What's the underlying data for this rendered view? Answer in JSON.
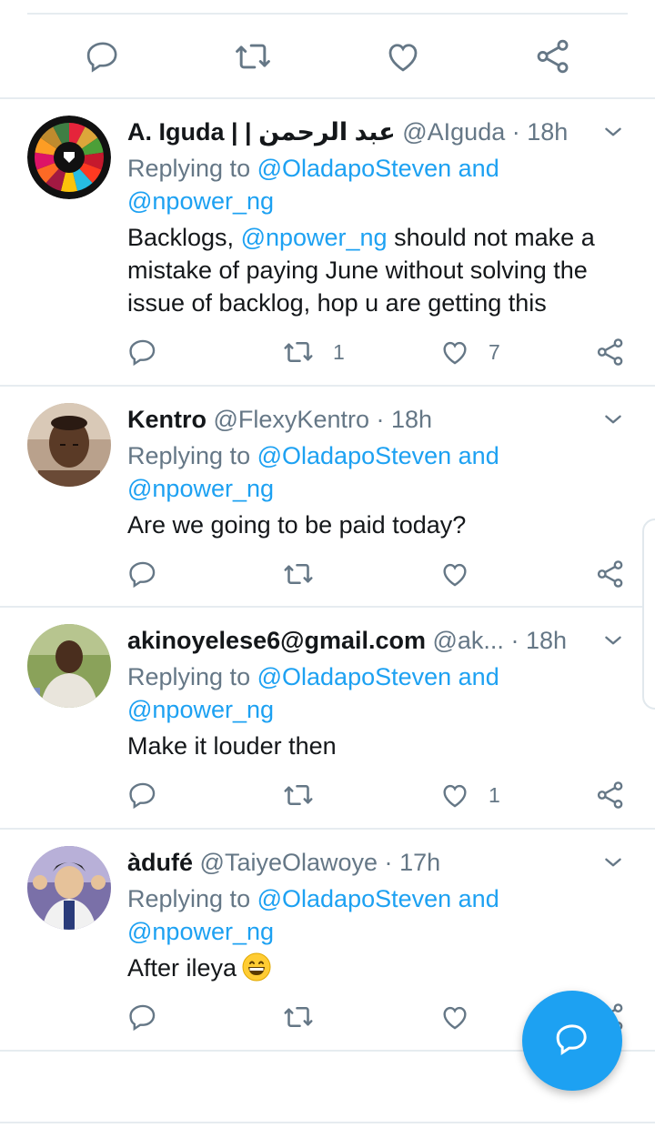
{
  "top_actions": [
    "reply-icon",
    "retweet-icon",
    "like-icon",
    "share-icon"
  ],
  "tweets": [
    {
      "name": "A. Iguda | | عبد الرحمن",
      "handle": "@AIguda",
      "dot": "·",
      "time": "18h",
      "replying_prefix": "Replying to",
      "replying_to_1": "@OladapoSteven and",
      "replying_to_2": "@npower_ng",
      "body_prefix": "Backlogs, ",
      "body_mention": "@npower_ng",
      "body_rest_1": " should not make a",
      "body_line_2": "mistake of paying June without solving the",
      "body_line_3": "issue of backlog, hop u are getting this",
      "retweets": "1",
      "likes": "7"
    },
    {
      "name": "Kentro",
      "handle": "@FlexyKentro",
      "dot": "·",
      "time": "18h",
      "replying_prefix": "Replying to",
      "replying_to_1": "@OladapoSteven and",
      "replying_to_2": "@npower_ng",
      "body": "Are we going to be paid today?",
      "retweets": "",
      "likes": ""
    },
    {
      "name": "akinoyelese6@gmail.com",
      "handle": "@ak...",
      "dot": "·",
      "time": "18h",
      "replying_prefix": "Replying to",
      "replying_to_1": "@OladapoSteven and",
      "replying_to_2": "@npower_ng",
      "body": "Make it louder then",
      "retweets": "",
      "likes": "1"
    },
    {
      "name": "àdufé",
      "handle": "@TaiyeOlawoye",
      "dot": "·",
      "time": "17h",
      "replying_prefix": "Replying to",
      "replying_to_1": "@OladapoSteven and",
      "replying_to_2": "@npower_ng",
      "body": "After ileya",
      "body_emoji": "grinning-face-emoji",
      "retweets": "",
      "likes": ""
    }
  ],
  "fab": {
    "icon": "compose-reply-icon"
  },
  "colors": {
    "accent": "#1da1f2",
    "muted": "#657786",
    "text": "#14171a",
    "divider": "#e6ecf0"
  }
}
